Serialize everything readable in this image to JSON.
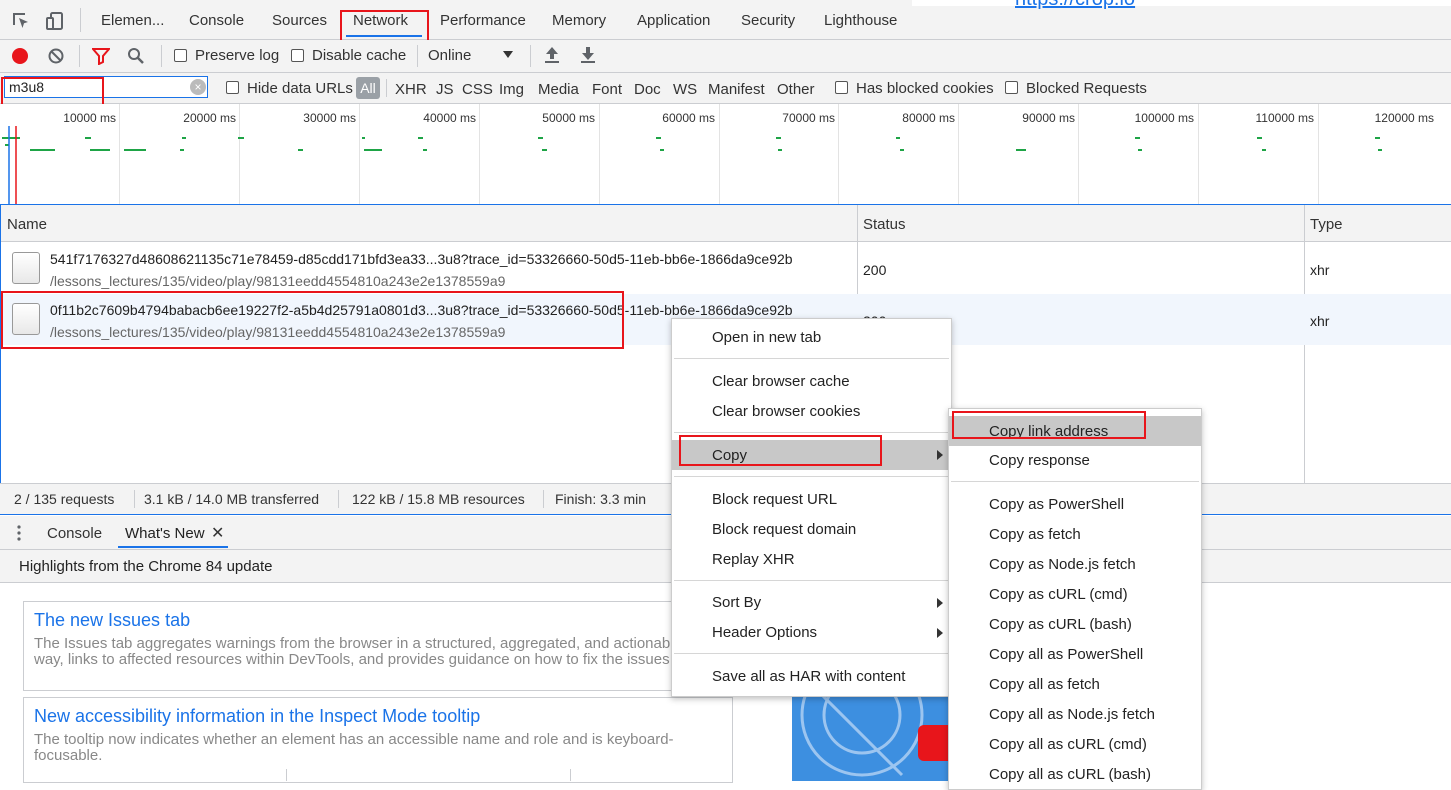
{
  "devtools": {
    "tabs": [
      "Elemen...",
      "Console",
      "Sources",
      "Network",
      "Performance",
      "Memory",
      "Application",
      "Security",
      "Lighthouse"
    ],
    "url_fragment": "https://crop.io"
  },
  "toolbar": {
    "preserve_log": "Preserve log",
    "disable_cache": "Disable cache",
    "throttle": "Online"
  },
  "filter": {
    "value": "m3u8",
    "hide_data_urls": "Hide data URLs",
    "types": [
      "All",
      "XHR",
      "JS",
      "CSS",
      "Img",
      "Media",
      "Font",
      "Doc",
      "WS",
      "Manifest",
      "Other"
    ],
    "has_blocked_cookies": "Has blocked cookies",
    "blocked_requests": "Blocked Requests"
  },
  "overview": {
    "ticks": [
      "10000 ms",
      "20000 ms",
      "30000 ms",
      "40000 ms",
      "50000 ms",
      "60000 ms",
      "70000 ms",
      "80000 ms",
      "90000 ms",
      "100000 ms",
      "110000 ms",
      "120000 ms"
    ]
  },
  "table": {
    "columns": {
      "name": "Name",
      "status": "Status",
      "type": "Type"
    },
    "rows": [
      {
        "name": "541f7176327d48608621135c71e78459-d85cdd171bfd3ea33...3u8?trace_id=53326660-50d5-11eb-bb6e-1866da9ce92b",
        "path": "/lessons_lectures/135/video/play/98131eedd4554810a243e2e1378559a9",
        "status": "200",
        "type": "xhr"
      },
      {
        "name": "0f11b2c7609b4794babacb6ee19227f2-a5b4d25791a0801d3...3u8?trace_id=53326660-50d5-11eb-bb6e-1866da9ce92b",
        "path": "/lessons_lectures/135/video/play/98131eedd4554810a243e2e1378559a9",
        "status": "200",
        "type": "xhr"
      }
    ]
  },
  "statusbar": {
    "requests": "2 / 135 requests",
    "transferred": "3.1 kB / 14.0 MB transferred",
    "resources": "122 kB / 15.8 MB resources",
    "finish": "Finish: 3.3 min"
  },
  "drawer": {
    "tabs": [
      "Console",
      "What's New"
    ],
    "subtitle": "Highlights from the Chrome 84 update",
    "cards": [
      {
        "title": "The new Issues tab",
        "text": "The Issues tab aggregates warnings from the browser in a structured, aggregated, and actionable way, links to affected resources within DevTools, and provides guidance on how to fix the issues."
      },
      {
        "title": "New accessibility information in the Inspect Mode tooltip",
        "text": "The tooltip now indicates whether an element has an accessible name and role and is keyboard-focusable."
      }
    ]
  },
  "context_menu": {
    "items": [
      "Open in new tab",
      "Clear browser cache",
      "Clear browser cookies",
      "Copy",
      "Block request URL",
      "Block request domain",
      "Replay XHR",
      "Sort By",
      "Header Options",
      "Save all as HAR with content"
    ]
  },
  "copy_submenu": {
    "items": [
      "Copy link address",
      "Copy response",
      "Copy as PowerShell",
      "Copy as fetch",
      "Copy as Node.js fetch",
      "Copy as cURL (cmd)",
      "Copy as cURL (bash)",
      "Copy all as PowerShell",
      "Copy all as fetch",
      "Copy all as Node.js fetch",
      "Copy all as cURL (cmd)",
      "Copy all as cURL (bash)"
    ]
  },
  "colors": {
    "accent": "#1a73e8",
    "record": "#e8151b",
    "annotation": "#e8151b",
    "waterfall": "#1ea446"
  }
}
